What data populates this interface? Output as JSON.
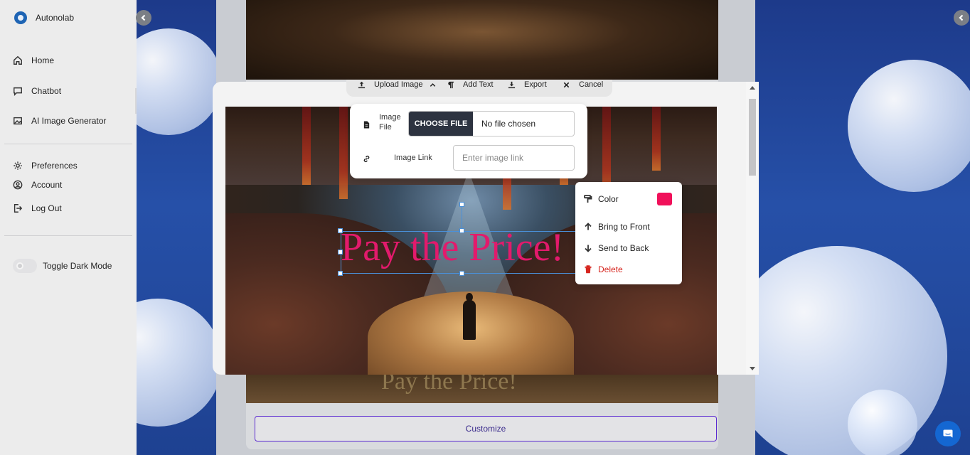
{
  "app": {
    "name": "Autonolab"
  },
  "sidebar": {
    "nav": [
      {
        "label": "Home",
        "icon": "home-icon"
      },
      {
        "label": "Chatbot",
        "icon": "chat-icon"
      },
      {
        "label": "AI Image Generator",
        "icon": "image-icon"
      }
    ],
    "settings": [
      {
        "label": "Preferences",
        "icon": "gear-icon"
      },
      {
        "label": "Account",
        "icon": "user-icon"
      },
      {
        "label": "Log Out",
        "icon": "logout-icon"
      }
    ],
    "toggle_label": "Toggle Dark Mode"
  },
  "toolbar": {
    "upload": "Upload Image",
    "add_text": "Add Text",
    "export": "Export",
    "cancel": "Cancel"
  },
  "upload_popover": {
    "file_label": "Image File",
    "choose_file": "CHOOSE FILE",
    "file_status": "No file chosen",
    "link_label": "Image Link",
    "link_placeholder": "Enter image link"
  },
  "canvas": {
    "text": "Pay the Price!",
    "text_color": "#e21a6c"
  },
  "context_menu": {
    "color_label": "Color",
    "color_value": "#f0105a",
    "bring_to_front": "Bring to Front",
    "send_to_back": "Send to Back",
    "delete": "Delete"
  },
  "background": {
    "overlay_text": "Pay the Price!",
    "customize_label": "Customize"
  }
}
